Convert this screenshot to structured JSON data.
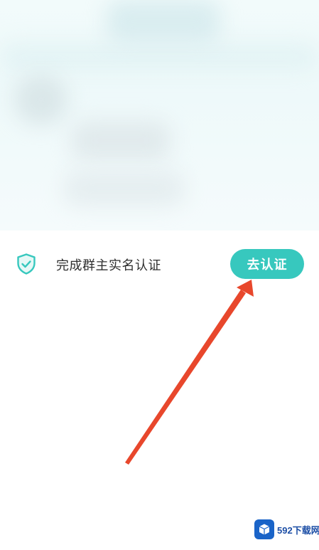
{
  "verification": {
    "text": "完成群主实名认证",
    "button_label": "去认证"
  },
  "colors": {
    "accent": "#37c8be",
    "shield_icon": "#37c8be",
    "arrow": "#e8472c"
  },
  "watermark": {
    "text": "592下载网"
  }
}
